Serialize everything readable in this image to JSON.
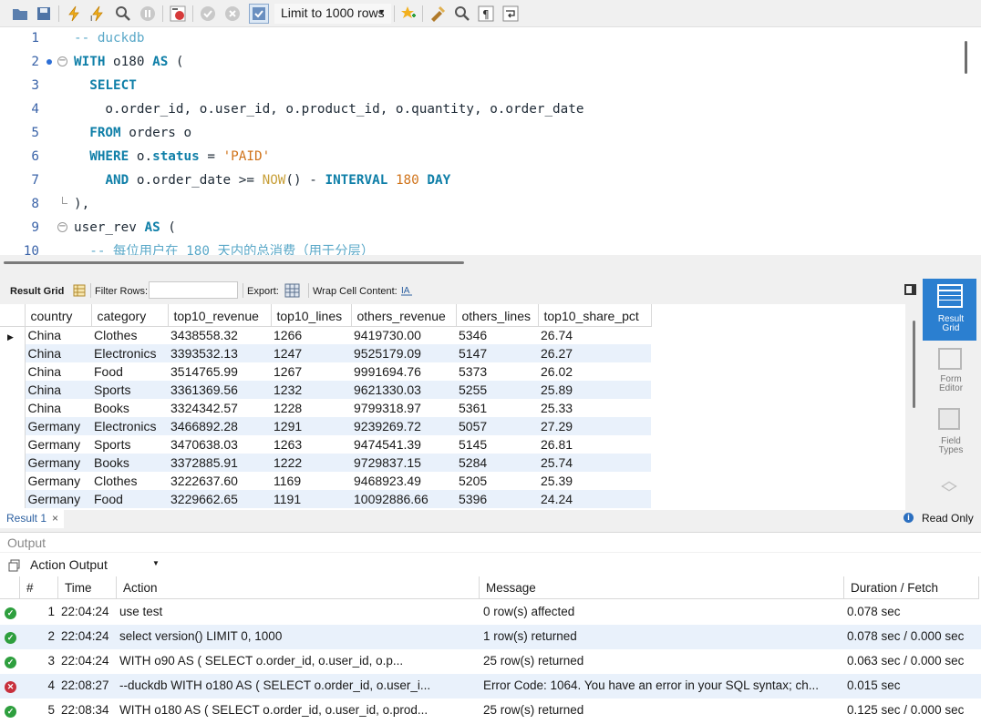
{
  "toolbar": {
    "limit_label": "Limit to 1000 rows",
    "icons": [
      "open-folder-icon",
      "save-icon",
      "execute-icon",
      "execute-current-icon",
      "explain-icon",
      "stop-icon",
      "toggle-error-icon",
      "commit-icon",
      "rollback-icon",
      "autocommit-icon",
      "beautify-icon",
      "find-icon",
      "invisible-chars-icon",
      "wrap-icon"
    ]
  },
  "editor": {
    "line_numbers": [
      "1",
      "2",
      "3",
      "4",
      "5",
      "6",
      "7",
      "8",
      "9",
      "10"
    ],
    "lines": [
      "-- duckdb",
      "WITH o180 AS (",
      "  SELECT",
      "    o.order_id, o.user_id, o.product_id, o.quantity, o.order_date",
      "  FROM orders o",
      "  WHERE o.status = 'PAID'",
      "    AND o.order_date >= NOW() - INTERVAL 180 DAY",
      "),",
      "user_rev AS (",
      "  -- 每位用户在 180 天内的总消费（用于分层）"
    ]
  },
  "result_toolbar": {
    "result_grid": "Result Grid",
    "filter_rows": "Filter Rows:",
    "filter_value": "",
    "export": "Export:",
    "wrap": "Wrap Cell Content:"
  },
  "grid": {
    "columns": [
      "country",
      "category",
      "top10_revenue",
      "top10_lines",
      "others_revenue",
      "others_lines",
      "top10_share_pct"
    ],
    "rows": [
      [
        "China",
        "Clothes",
        "3438558.32",
        "1266",
        "9419730.00",
        "5346",
        "26.74"
      ],
      [
        "China",
        "Electronics",
        "3393532.13",
        "1247",
        "9525179.09",
        "5147",
        "26.27"
      ],
      [
        "China",
        "Food",
        "3514765.99",
        "1267",
        "9991694.76",
        "5373",
        "26.02"
      ],
      [
        "China",
        "Sports",
        "3361369.56",
        "1232",
        "9621330.03",
        "5255",
        "25.89"
      ],
      [
        "China",
        "Books",
        "3324342.57",
        "1228",
        "9799318.97",
        "5361",
        "25.33"
      ],
      [
        "Germany",
        "Electronics",
        "3466892.28",
        "1291",
        "9239269.72",
        "5057",
        "27.29"
      ],
      [
        "Germany",
        "Sports",
        "3470638.03",
        "1263",
        "9474541.39",
        "5145",
        "26.81"
      ],
      [
        "Germany",
        "Books",
        "3372885.91",
        "1222",
        "9729837.15",
        "5284",
        "25.74"
      ],
      [
        "Germany",
        "Clothes",
        "3222637.60",
        "1169",
        "9468923.49",
        "5205",
        "25.39"
      ],
      [
        "Germany",
        "Food",
        "3229662.65",
        "1191",
        "10092886.66",
        "5396",
        "24.24"
      ]
    ]
  },
  "side_panel": {
    "result_grid": [
      "Result",
      "Grid"
    ],
    "form_editor": [
      "Form",
      "Editor"
    ],
    "field_types": [
      "Field",
      "Types"
    ]
  },
  "result_tab": {
    "label": "Result 1",
    "read_only": "Read Only"
  },
  "output": {
    "header": "Output",
    "selector": "Action Output",
    "columns": [
      "#",
      "Time",
      "Action",
      "Message",
      "Duration / Fetch"
    ],
    "rows": [
      {
        "status": "ok",
        "num": "1",
        "time": "22:04:24",
        "action": "use test",
        "message": "0 row(s) affected",
        "duration": "0.078 sec"
      },
      {
        "status": "ok",
        "num": "2",
        "time": "22:04:24",
        "action": "select version() LIMIT 0, 1000",
        "message": "1 row(s) returned",
        "duration": "0.078 sec / 0.000 sec"
      },
      {
        "status": "ok",
        "num": "3",
        "time": "22:04:24",
        "action": "WITH o90 AS (   SELECT      o.order_id,      o.user_id,      o.p...",
        "message": "25 row(s) returned",
        "duration": "0.063 sec / 0.000 sec"
      },
      {
        "status": "error",
        "num": "4",
        "time": "22:08:27",
        "action": "--duckdb WITH o180 AS (   SELECT      o.order_id, o.user_i...",
        "message": "Error Code: 1064. You have an error in your SQL syntax; ch...",
        "duration": "0.015 sec"
      },
      {
        "status": "ok",
        "num": "5",
        "time": "22:08:34",
        "action": "WITH o180 AS (   SELECT      o.order_id, o.user_id, o.prod...",
        "message": "25 row(s) returned",
        "duration": "0.125 sec / 0.000 sec"
      }
    ]
  },
  "colors": {
    "keyword": "#0f7fa8",
    "comment": "#5aa8c8",
    "string": "#d0731a",
    "selected_panel": "#2b7fd0",
    "alt_row": "#e9f1fb",
    "ok": "#2e9f3e",
    "error": "#c8303c"
  }
}
